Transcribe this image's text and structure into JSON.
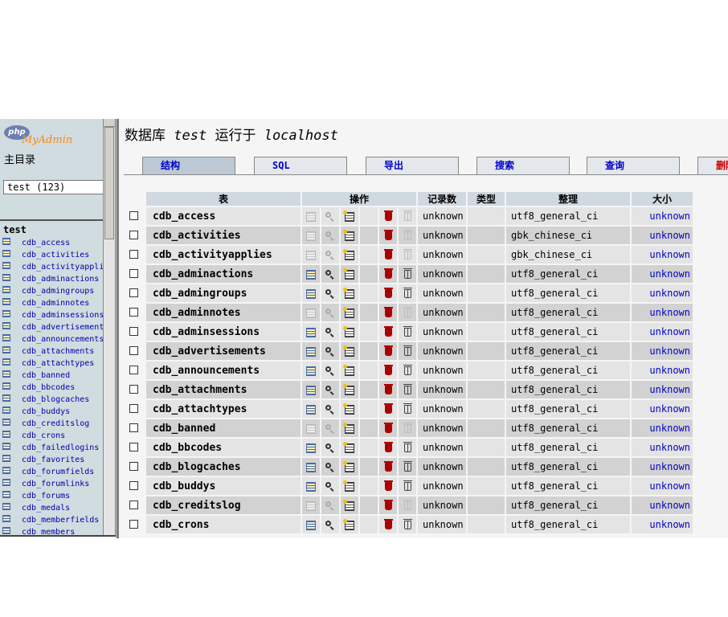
{
  "left": {
    "logo_php": "php",
    "logo_myadmin": "MyAdmin",
    "home_label": "主目录",
    "db_select_value": "test (123)",
    "db_name": "test",
    "tables": [
      "cdb_access",
      "cdb_activities",
      "cdb_activityapplies",
      "cdb_adminactions",
      "cdb_admingroups",
      "cdb_adminnotes",
      "cdb_adminsessions",
      "cdb_advertisements",
      "cdb_announcements",
      "cdb_attachments",
      "cdb_attachtypes",
      "cdb_banned",
      "cdb_bbcodes",
      "cdb_blogcaches",
      "cdb_buddys",
      "cdb_creditslog",
      "cdb_crons",
      "cdb_failedlogins",
      "cdb_favorites",
      "cdb_forumfields",
      "cdb_forumlinks",
      "cdb_forums",
      "cdb_medals",
      "cdb_memberfields",
      "cdb_members"
    ]
  },
  "header": {
    "title_prefix": "数据库",
    "db": "test",
    "title_mid": "运行于",
    "host": "localhost"
  },
  "tabs": [
    {
      "label": "结构",
      "active": true
    },
    {
      "label": "SQL",
      "active": false
    },
    {
      "label": "导出",
      "active": false
    },
    {
      "label": "搜索",
      "active": false
    },
    {
      "label": "查询",
      "active": false
    },
    {
      "label": "删除",
      "active": false
    }
  ],
  "table": {
    "headers": {
      "table": "表",
      "actions": "操作",
      "records": "记录数",
      "type": "类型",
      "collation": "整理",
      "size": "大小"
    },
    "rows": [
      {
        "name": "cdb_access",
        "records": "unknown",
        "type": "",
        "collation": "utf8_general_ci",
        "size": "unknown",
        "enabled": false
      },
      {
        "name": "cdb_activities",
        "records": "unknown",
        "type": "",
        "collation": "gbk_chinese_ci",
        "size": "unknown",
        "enabled": false
      },
      {
        "name": "cdb_activityapplies",
        "records": "unknown",
        "type": "",
        "collation": "gbk_chinese_ci",
        "size": "unknown",
        "enabled": false
      },
      {
        "name": "cdb_adminactions",
        "records": "unknown",
        "type": "",
        "collation": "utf8_general_ci",
        "size": "unknown",
        "enabled": true
      },
      {
        "name": "cdb_admingroups",
        "records": "unknown",
        "type": "",
        "collation": "utf8_general_ci",
        "size": "unknown",
        "enabled": true
      },
      {
        "name": "cdb_adminnotes",
        "records": "unknown",
        "type": "",
        "collation": "utf8_general_ci",
        "size": "unknown",
        "enabled": false
      },
      {
        "name": "cdb_adminsessions",
        "records": "unknown",
        "type": "",
        "collation": "utf8_general_ci",
        "size": "unknown",
        "enabled": true
      },
      {
        "name": "cdb_advertisements",
        "records": "unknown",
        "type": "",
        "collation": "utf8_general_ci",
        "size": "unknown",
        "enabled": true
      },
      {
        "name": "cdb_announcements",
        "records": "unknown",
        "type": "",
        "collation": "utf8_general_ci",
        "size": "unknown",
        "enabled": true
      },
      {
        "name": "cdb_attachments",
        "records": "unknown",
        "type": "",
        "collation": "utf8_general_ci",
        "size": "unknown",
        "enabled": true
      },
      {
        "name": "cdb_attachtypes",
        "records": "unknown",
        "type": "",
        "collation": "utf8_general_ci",
        "size": "unknown",
        "enabled": true
      },
      {
        "name": "cdb_banned",
        "records": "unknown",
        "type": "",
        "collation": "utf8_general_ci",
        "size": "unknown",
        "enabled": false
      },
      {
        "name": "cdb_bbcodes",
        "records": "unknown",
        "type": "",
        "collation": "utf8_general_ci",
        "size": "unknown",
        "enabled": true
      },
      {
        "name": "cdb_blogcaches",
        "records": "unknown",
        "type": "",
        "collation": "utf8_general_ci",
        "size": "unknown",
        "enabled": true
      },
      {
        "name": "cdb_buddys",
        "records": "unknown",
        "type": "",
        "collation": "utf8_general_ci",
        "size": "unknown",
        "enabled": true
      },
      {
        "name": "cdb_creditslog",
        "records": "unknown",
        "type": "",
        "collation": "utf8_general_ci",
        "size": "unknown",
        "enabled": false
      },
      {
        "name": "cdb_crons",
        "records": "unknown",
        "type": "",
        "collation": "utf8_general_ci",
        "size": "unknown",
        "enabled": true
      }
    ]
  },
  "icons": {
    "browse": "table-browse-icon",
    "search": "magnifier-search-icon",
    "insert": "insert-row-icon",
    "properties": "properties-icon",
    "drop": "drop-trash-icon",
    "empty": "empty-trash-icon"
  },
  "colors": {
    "link": "#0000cc",
    "danger": "#cc0000",
    "tab_active": "#bcc8d4",
    "header_bg": "#d0d8e0"
  }
}
